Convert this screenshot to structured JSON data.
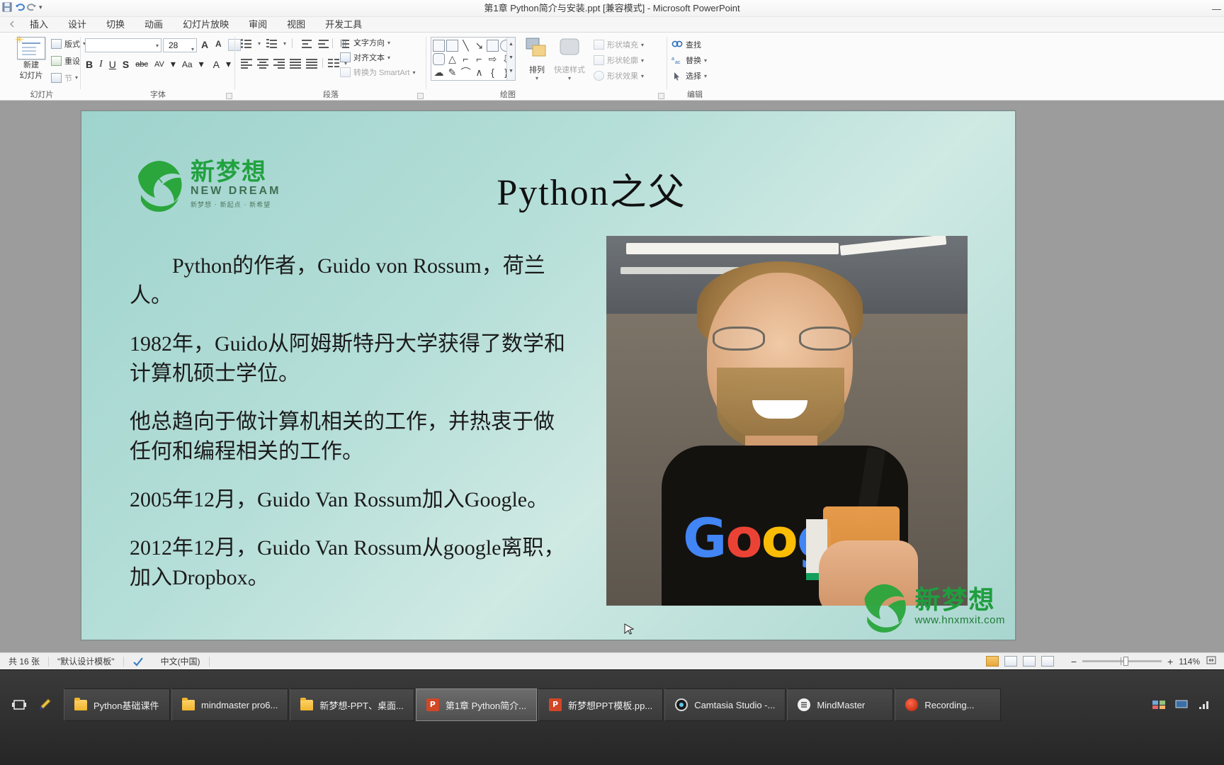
{
  "window": {
    "title": "第1章 Python简介与安装.ppt [兼容模式]  -  Microsoft PowerPoint",
    "minimize": "—",
    "qat_caret": "▾"
  },
  "ribbon": {
    "tabs": [
      {
        "label": "",
        "name": "tab-file"
      },
      {
        "label": "插入",
        "name": "tab-insert"
      },
      {
        "label": "设计",
        "name": "tab-design"
      },
      {
        "label": "切换",
        "name": "tab-transitions"
      },
      {
        "label": "动画",
        "name": "tab-animations"
      },
      {
        "label": "幻灯片放映",
        "name": "tab-slideshow"
      },
      {
        "label": "审阅",
        "name": "tab-review"
      },
      {
        "label": "视图",
        "name": "tab-view"
      },
      {
        "label": "开发工具",
        "name": "tab-developer"
      }
    ],
    "groups": {
      "slide": {
        "label": "幻灯片",
        "new_slide_line1": "新建",
        "new_slide_line2": "幻灯片",
        "layout": "版式",
        "reset": "重设",
        "section": "节"
      },
      "font": {
        "label": "字体",
        "font_name": "",
        "font_size": "28",
        "grow": "A",
        "shrink": "A",
        "clear_format": "A",
        "bold": "B",
        "italic": "I",
        "underline": "U",
        "shadow": "S",
        "strike": "abc",
        "spacing": "AV",
        "case": "Aa",
        "color": "A"
      },
      "paragraph": {
        "label": "段落",
        "text_direction": "文字方向",
        "align_text": "对齐文本",
        "convert_smartart": "转换为 SmartArt"
      },
      "drawing": {
        "label": "绘图",
        "arrange": "排列",
        "quick_styles": "快速样式"
      },
      "shape": {
        "shape_fill": "形状填充",
        "shape_outline": "形状轮廓",
        "shape_effects": "形状效果"
      },
      "editing": {
        "label": "编辑",
        "find": "查找",
        "replace": "替换",
        "select": "选择"
      }
    }
  },
  "slide": {
    "logo": {
      "cn": "新梦想",
      "en": "NEW DREAM",
      "tagline": "新梦想 · 新起点 · 新希望"
    },
    "title": "Python之父",
    "paragraphs": [
      "Python的作者，Guido von Rossum，荷兰人。",
      "1982年，Guido从阿姆斯特丹大学获得了数学和计算机硕士学位。",
      "他总趋向于做计算机相关的工作，并热衷于做任何和编程相关的工作。",
      "2005年12月，Guido Van Rossum加入Google。",
      "2012年12月，Guido Van Rossum从google离职，加入Dropbox。"
    ],
    "photo_text": "Google",
    "watermark": {
      "cn": "新梦想",
      "url": "www.hnxmxit.com"
    },
    "background_color": "#a9d6d0"
  },
  "status_bar": {
    "slide_count": "共 16 张",
    "theme": "\"默认设计模板\"",
    "language": "中文(中国)",
    "zoom": "114%",
    "zoom_out": "−",
    "zoom_in": "+",
    "fit_icon": "fit-slide-icon"
  },
  "taskbar": {
    "items": [
      {
        "label": "Python基础课件",
        "icon": "folder-icon",
        "active": false
      },
      {
        "label": "mindmaster pro6...",
        "icon": "folder-icon",
        "active": false
      },
      {
        "label": "新梦想-PPT、桌面...",
        "icon": "folder-icon",
        "active": false
      },
      {
        "label": "第1章 Python简介...",
        "icon": "powerpoint-icon",
        "active": true
      },
      {
        "label": "新梦想PPT模板.pp...",
        "icon": "powerpoint-icon",
        "active": false
      },
      {
        "label": "Camtasia Studio -...",
        "icon": "camtasia-icon",
        "active": false
      },
      {
        "label": "MindMaster",
        "icon": "mindmaster-icon",
        "active": false
      },
      {
        "label": "Recording...",
        "icon": "recording-icon",
        "active": false
      }
    ]
  }
}
